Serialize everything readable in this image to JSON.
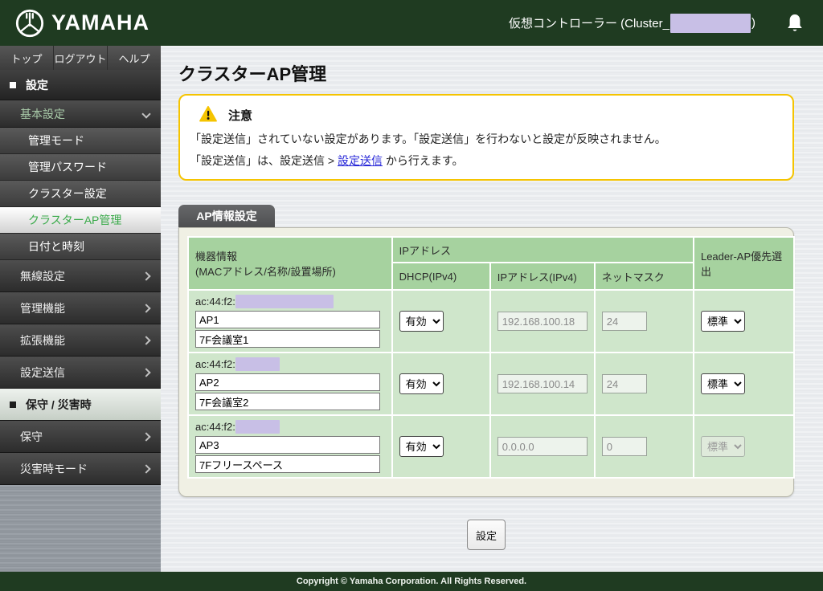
{
  "header": {
    "brand": "YAMAHA",
    "controller_prefix": "仮想コントローラー (Cluster_",
    "controller_suffix": ")"
  },
  "sidebar": {
    "tabs": [
      {
        "label": "トップ"
      },
      {
        "label": "ログアウト"
      },
      {
        "label": "ヘルプ"
      }
    ],
    "section_settings": "設定",
    "basic_settings_label": "基本設定",
    "basic_items": [
      {
        "label": "管理モード"
      },
      {
        "label": "管理パスワード"
      },
      {
        "label": "クラスター設定"
      },
      {
        "label": "クラスターAP管理"
      },
      {
        "label": "日付と時刻"
      }
    ],
    "menu_items": [
      {
        "label": "無線設定"
      },
      {
        "label": "管理機能"
      },
      {
        "label": "拡張機能"
      },
      {
        "label": "設定送信"
      }
    ],
    "section_maintenance": "保守 / 災害時",
    "maintenance_items": [
      {
        "label": "保守"
      },
      {
        "label": "災害時モード"
      }
    ]
  },
  "main": {
    "page_title": "クラスターAP管理",
    "warning": {
      "title": "注意",
      "line1": "「設定送信」されていない設定があります。「設定送信」を行わないと設定が反映されません。",
      "line2_prefix": "「設定送信」は、設定送信 > ",
      "line2_link": "設定送信",
      "line2_suffix": " から行えます。"
    },
    "tab_label": "AP情報設定",
    "table": {
      "col_device": "機器情報",
      "col_device_sub": "(MACアドレス/名称/設置場所)",
      "col_ip_group": "IPアドレス",
      "col_dhcp": "DHCP(IPv4)",
      "col_ip": "IPアドレス(IPv4)",
      "col_netmask": "ネットマスク",
      "col_leader": "Leader-AP優先選出",
      "rows": [
        {
          "mac_prefix": "ac:44:f2:",
          "name": "AP1",
          "location": "7F会議室1",
          "dhcp": "有効",
          "ip": "192.168.100.18",
          "netmask": "24",
          "leader": "標準"
        },
        {
          "mac_prefix": "ac:44:f2:",
          "name": "AP2",
          "location": "7F会議室2",
          "dhcp": "有効",
          "ip": "192.168.100.14",
          "netmask": "24",
          "leader": "標準"
        },
        {
          "mac_prefix": "ac:44:f2:",
          "name": "AP3",
          "location": "7Fフリースペース",
          "dhcp": "有効",
          "ip": "0.0.0.0",
          "netmask": "0",
          "leader": "標準"
        }
      ]
    },
    "submit_label": "設定"
  },
  "footer": {
    "copyright": "Copyright © Yamaha Corporation. All Rights Reserved."
  },
  "colors": {
    "brand_green": "#1f3b21",
    "table_header_green": "#a6d29f",
    "table_cell_green": "#cfe6cb",
    "warning_border": "#f5c400",
    "link_blue": "#2727d8",
    "selected_text_green": "#3aaa4a",
    "redaction_purple": "#c8bfe6"
  }
}
